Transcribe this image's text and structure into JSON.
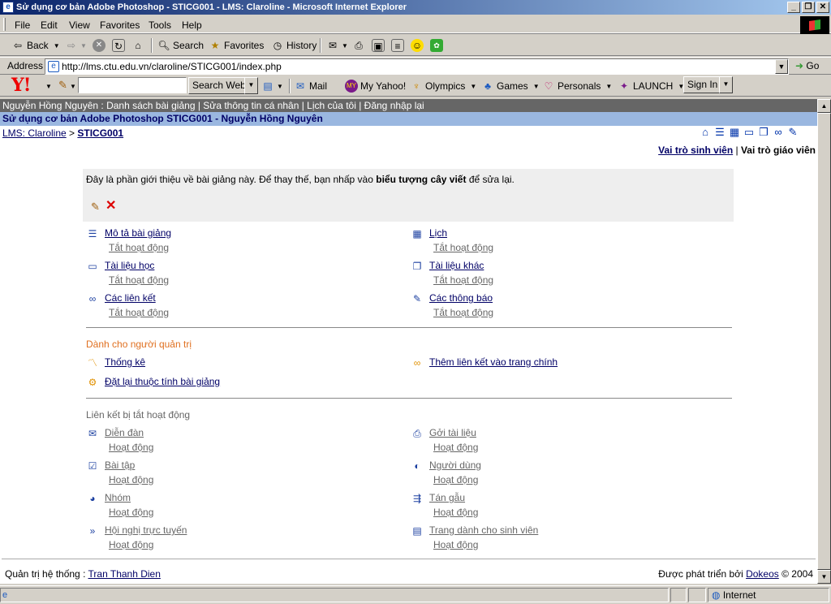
{
  "window": {
    "title": "Sử dụng cơ bản Adobe Photoshop - STICG001 - LMS: Claroline - Microsoft Internet Explorer"
  },
  "menubar": [
    "File",
    "Edit",
    "View",
    "Favorites",
    "Tools",
    "Help"
  ],
  "toolbar": {
    "back": "Back",
    "search": "Search",
    "favorites": "Favorites",
    "history": "History"
  },
  "address": {
    "label": "Address",
    "url": "http://lms.ctu.edu.vn/claroline/STICG001/index.php",
    "go": "Go"
  },
  "yahoo": {
    "logo": "Y!",
    "search_button": "Search Web",
    "mail": "Mail",
    "myyahoo": "My Yahoo!",
    "olympics": "Olympics",
    "games": "Games",
    "personals": "Personals",
    "launch": "LAUNCH",
    "signin": "Sign In"
  },
  "page": {
    "userbar": "Nguyễn Hồng Nguyên : Danh sách bài giảng | Sửa thông tin cá nhân | Lịch của tôi | Đăng nhập lại",
    "course_title": "Sử dụng cơ bản Adobe Photoshop STICG001 - Nguyễn Hồng Nguyên",
    "breadcrumb": {
      "root": "LMS: Claroline",
      "sep": " > ",
      "current": "STICG001"
    },
    "roles": {
      "student": "Vai trò sinh viên",
      "sep": " | ",
      "teacher": "Vai trò giáo viên"
    },
    "intro": {
      "before": "Đây là phần giới thiệu về bài giảng này. Để thay thế, bạn nhấp vào ",
      "bold": "biểu tượng cây viết",
      "after": " để sửa lại."
    },
    "tools_left": [
      {
        "label": "Mô tả bài giảng",
        "status": "Tắt hoạt động"
      },
      {
        "label": "Tài liệu học",
        "status": "Tắt hoạt động"
      },
      {
        "label": "Các liên kết",
        "status": "Tắt hoạt động"
      }
    ],
    "tools_right": [
      {
        "label": "Lịch",
        "status": "Tắt hoạt động"
      },
      {
        "label": "Tài liệu khác",
        "status": "Tắt hoạt động"
      },
      {
        "label": "Các thông báo",
        "status": "Tắt hoạt động"
      }
    ],
    "admin": {
      "heading": "Dành cho người quản trị",
      "stats": "Thống kê",
      "add_link": "Thêm liên kết vào trang chính",
      "reset": "Đặt lại thuộc tính bài giảng"
    },
    "disabled": {
      "heading": "Liên kết bị tắt hoạt động",
      "left": [
        {
          "label": "Diễn đàn",
          "status": "Hoạt động"
        },
        {
          "label": "Bài tập",
          "status": "Hoạt động"
        },
        {
          "label": "Nhóm",
          "status": "Hoạt động"
        },
        {
          "label": "Hội nghị trực tuyến",
          "status": "Hoạt động"
        }
      ],
      "right": [
        {
          "label": "Gởi tài liệu",
          "status": "Hoạt động"
        },
        {
          "label": "Người dùng",
          "status": "Hoạt động"
        },
        {
          "label": "Tán gẫu",
          "status": "Hoạt động"
        },
        {
          "label": "Trang dành cho sinh viên",
          "status": "Hoạt động"
        }
      ]
    },
    "footer": {
      "admin_label": "Quản trị hệ thống : ",
      "admin_name": "Tran Thanh Dien",
      "dev_label": "Được phát triển bởi ",
      "dev_name": "Dokeos",
      "copyright": " © 2004"
    }
  },
  "status": {
    "zone": "Internet"
  }
}
